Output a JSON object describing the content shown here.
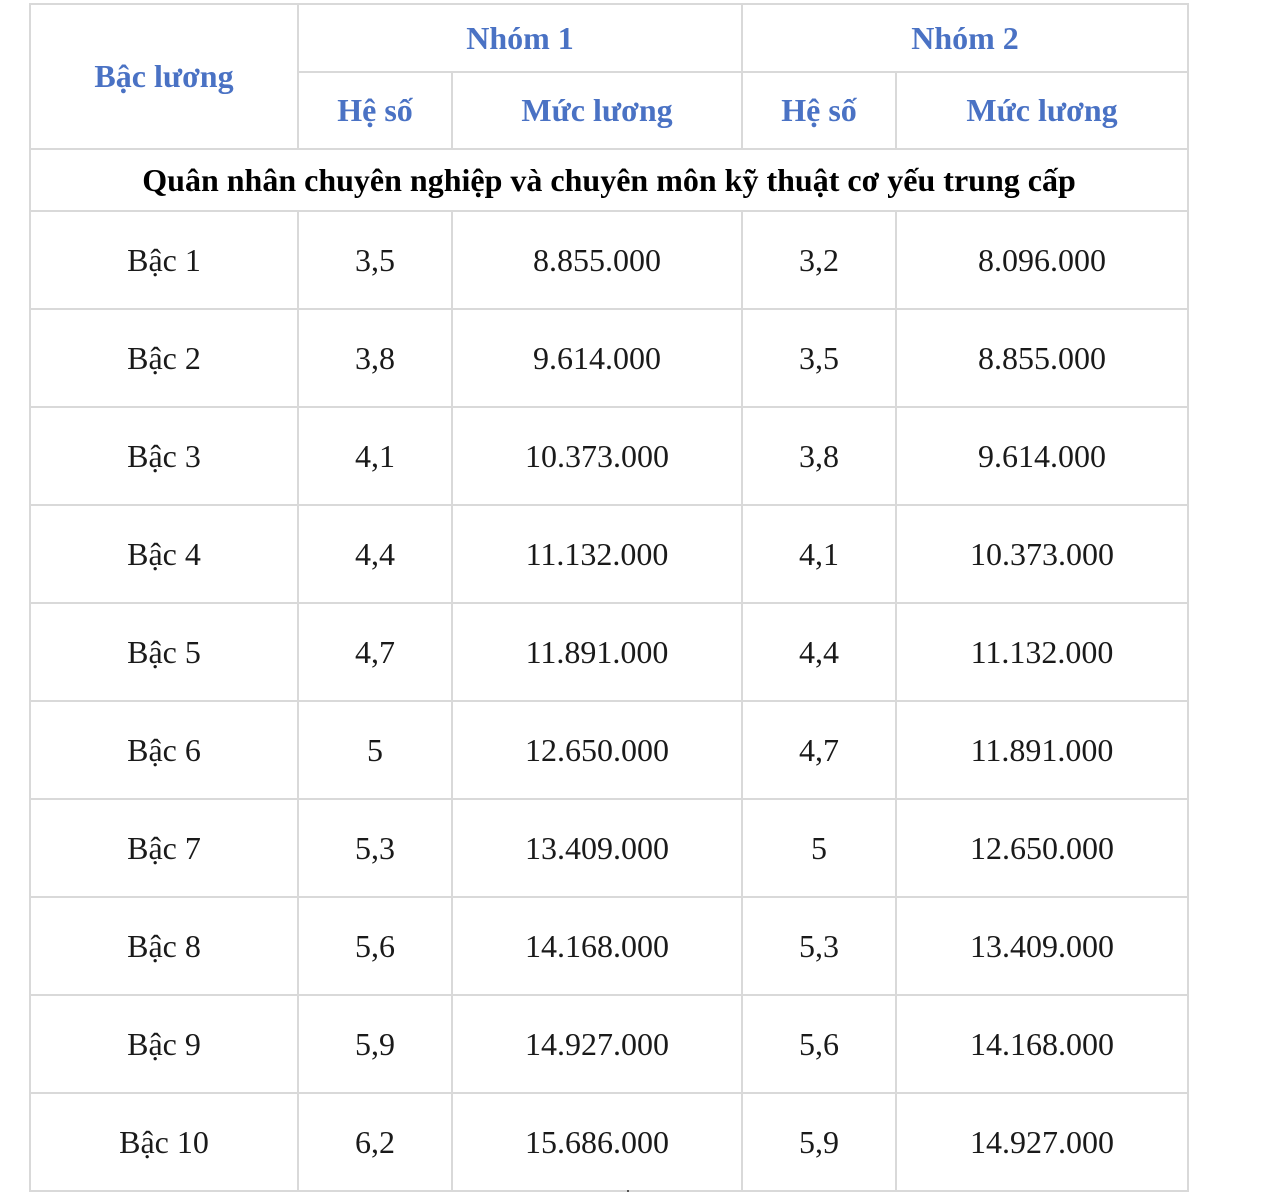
{
  "header": {
    "col_level": "Bậc lương",
    "group1": "Nhóm 1",
    "group2": "Nhóm 2",
    "coef": "Hệ số",
    "salary": "Mức lương"
  },
  "section_title": "Quân nhân chuyên nghiệp và chuyên môn kỹ thuật cơ yếu trung cấp",
  "rows": [
    {
      "level": "Bậc 1",
      "g1_coef": "3,5",
      "g1_salary": "8.855.000",
      "g2_coef": "3,2",
      "g2_salary": "8.096.000"
    },
    {
      "level": "Bậc 2",
      "g1_coef": "3,8",
      "g1_salary": "9.614.000",
      "g2_coef": "3,5",
      "g2_salary": "8.855.000"
    },
    {
      "level": "Bậc 3",
      "g1_coef": "4,1",
      "g1_salary": "10.373.000",
      "g2_coef": "3,8",
      "g2_salary": "9.614.000"
    },
    {
      "level": "Bậc 4",
      "g1_coef": "4,4",
      "g1_salary": "11.132.000",
      "g2_coef": "4,1",
      "g2_salary": "10.373.000"
    },
    {
      "level": "Bậc 5",
      "g1_coef": "4,7",
      "g1_salary": "11.891.000",
      "g2_coef": "4,4",
      "g2_salary": "11.132.000"
    },
    {
      "level": "Bậc 6",
      "g1_coef": "5",
      "g1_salary": "12.650.000",
      "g2_coef": "4,7",
      "g2_salary": "11.891.000"
    },
    {
      "level": "Bậc 7",
      "g1_coef": "5,3",
      "g1_salary": "13.409.000",
      "g2_coef": "5",
      "g2_salary": "12.650.000"
    },
    {
      "level": "Bậc 8",
      "g1_coef": "5,6",
      "g1_salary": "14.168.000",
      "g2_coef": "5,3",
      "g2_salary": "13.409.000"
    },
    {
      "level": "Bậc 9",
      "g1_coef": "5,9",
      "g1_salary": "14.927.000",
      "g2_coef": "5,6",
      "g2_salary": "14.168.000"
    },
    {
      "level": "Bậc 10",
      "g1_coef": "6,2",
      "g1_salary": "15.686.000",
      "g2_coef": "5,9",
      "g2_salary": "14.927.000"
    }
  ]
}
